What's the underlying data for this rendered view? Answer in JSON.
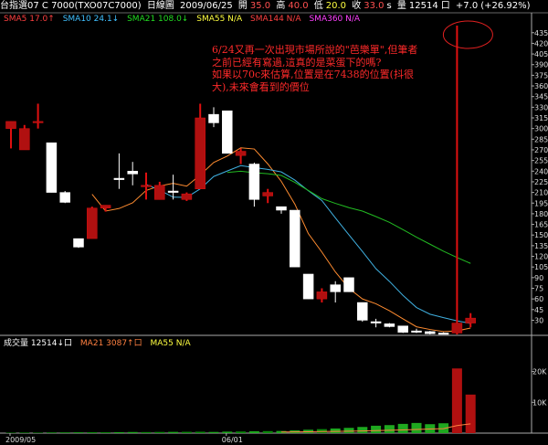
{
  "header": {
    "symbol": "台指選07 C 7000(TXO07C7000)",
    "view": "日線圖",
    "date": "2009/06/25",
    "open_label": "開",
    "open": "35.0",
    "high_label": "高",
    "high": "40.0",
    "low_label": "低",
    "low": "20.0",
    "close_label": "收",
    "close": "33.0",
    "close_suffix": "s",
    "volume_label": "量",
    "volume": "12514",
    "volume_unit": "口",
    "change": "+7.0",
    "change_pct": "(+26.92%)"
  },
  "indicators": [
    {
      "label": "SMA5 17.0↑",
      "color": "#ff4040"
    },
    {
      "label": "SMA10 24.1↓",
      "color": "#40c0ff"
    },
    {
      "label": "SMA21 108.0↓",
      "color": "#22dd22"
    },
    {
      "label": "SMA55 N/A",
      "color": "#ffff40"
    },
    {
      "label": "SMA144 N/A",
      "color": "#ff4040"
    },
    {
      "label": "SMA360 N/A",
      "color": "#ff40ff"
    }
  ],
  "volume_indicators": [
    {
      "label": "成交量 12514↓口",
      "color": "#ffffff"
    },
    {
      "label": "MA21 3087↑口",
      "color": "#ff8040"
    },
    {
      "label": "MA55 N/A",
      "color": "#ffff40"
    }
  ],
  "annotation": [
    "6/24又再一次出現市場所說的\"芭樂單\",但筆者",
    "之前已經有寫過,這真的是菜蛋下的嗎?",
    "如果以70c來估算,位置是在7438的位置(抖很",
    "大),未來會看到的價位"
  ],
  "chart_data": {
    "type": "candlestick",
    "y_ticks": [
      30,
      45,
      60,
      75,
      90,
      105,
      120,
      135,
      150,
      165,
      180,
      195,
      210,
      225,
      240,
      255,
      270,
      285,
      300,
      315,
      330,
      345,
      360,
      375,
      390,
      405,
      420,
      435
    ],
    "ylim": [
      10,
      445
    ],
    "volume_ticks": [
      "10K",
      "20K"
    ],
    "volume_tick_values": [
      10000,
      20000
    ],
    "volume_ylim": [
      0,
      27000
    ],
    "x_labels": [
      {
        "label": "2009/05",
        "index": 0
      },
      {
        "label": "06/01",
        "index": 16
      }
    ],
    "candles": [
      {
        "o": 300,
        "h": 310,
        "l": 272,
        "c": 310,
        "v": 150
      },
      {
        "o": 270,
        "h": 305,
        "l": 270,
        "c": 300,
        "v": 180
      },
      {
        "o": 310,
        "h": 335,
        "l": 300,
        "c": 310,
        "v": 160
      },
      {
        "o": 280,
        "h": 280,
        "l": 210,
        "c": 210,
        "v": 200
      },
      {
        "o": 210,
        "h": 212,
        "l": 195,
        "c": 196,
        "v": 220
      },
      {
        "o": 145,
        "h": 145,
        "l": 132,
        "c": 133,
        "v": 260
      },
      {
        "o": 145,
        "h": 190,
        "l": 145,
        "c": 188,
        "v": 300
      },
      {
        "o": 188,
        "h": 192,
        "l": 183,
        "c": 192,
        "v": 280
      },
      {
        "o": 230,
        "h": 265,
        "l": 215,
        "c": 228,
        "v": 320
      },
      {
        "o": 240,
        "h": 253,
        "l": 220,
        "c": 236,
        "v": 360
      },
      {
        "o": 218,
        "h": 238,
        "l": 200,
        "c": 220,
        "v": 340
      },
      {
        "o": 200,
        "h": 225,
        "l": 200,
        "c": 220,
        "v": 380
      },
      {
        "o": 212,
        "h": 235,
        "l": 200,
        "c": 210,
        "v": 400
      },
      {
        "o": 200,
        "h": 210,
        "l": 198,
        "c": 208,
        "v": 420
      },
      {
        "o": 215,
        "h": 335,
        "l": 215,
        "c": 315,
        "v": 450
      },
      {
        "o": 320,
        "h": 330,
        "l": 302,
        "c": 308,
        "v": 380
      },
      {
        "o": 325,
        "h": 325,
        "l": 265,
        "c": 265,
        "v": 480
      },
      {
        "o": 262,
        "h": 272,
        "l": 250,
        "c": 268,
        "v": 520
      },
      {
        "o": 250,
        "h": 252,
        "l": 190,
        "c": 200,
        "v": 600
      },
      {
        "o": 205,
        "h": 215,
        "l": 195,
        "c": 210,
        "v": 650
      },
      {
        "o": 190,
        "h": 190,
        "l": 180,
        "c": 185,
        "v": 700
      },
      {
        "o": 185,
        "h": 185,
        "l": 105,
        "c": 105,
        "v": 900
      },
      {
        "o": 95,
        "h": 95,
        "l": 60,
        "c": 60,
        "v": 1100
      },
      {
        "o": 60,
        "h": 75,
        "l": 55,
        "c": 70,
        "v": 1300
      },
      {
        "o": 80,
        "h": 85,
        "l": 55,
        "c": 70,
        "v": 1500
      },
      {
        "o": 90,
        "h": 90,
        "l": 70,
        "c": 70,
        "v": 1700
      },
      {
        "o": 55,
        "h": 55,
        "l": 28,
        "c": 30,
        "v": 2000
      },
      {
        "o": 28,
        "h": 32,
        "l": 20,
        "c": 26,
        "v": 2400
      },
      {
        "o": 25,
        "h": 26,
        "l": 20,
        "c": 21,
        "v": 2600
      },
      {
        "o": 22,
        "h": 22,
        "l": 12,
        "c": 13,
        "v": 3000
      },
      {
        "o": 15,
        "h": 18,
        "l": 12,
        "c": 14,
        "v": 3300
      },
      {
        "o": 14,
        "h": 15,
        "l": 10,
        "c": 11,
        "v": 2900
      },
      {
        "o": 12,
        "h": 13,
        "l": 10,
        "c": 11,
        "v": 3200
      },
      {
        "o": 12,
        "h": 445,
        "l": 10,
        "c": 26,
        "v": 21000
      },
      {
        "o": 26,
        "h": 40,
        "l": 20,
        "c": 33,
        "v": 12514
      }
    ],
    "series": [
      {
        "name": "SMA5",
        "color": "#ff8c30"
      },
      {
        "name": "SMA10",
        "color": "#40b0e0"
      },
      {
        "name": "SMA21",
        "color": "#22bb22"
      }
    ],
    "grid": false
  }
}
